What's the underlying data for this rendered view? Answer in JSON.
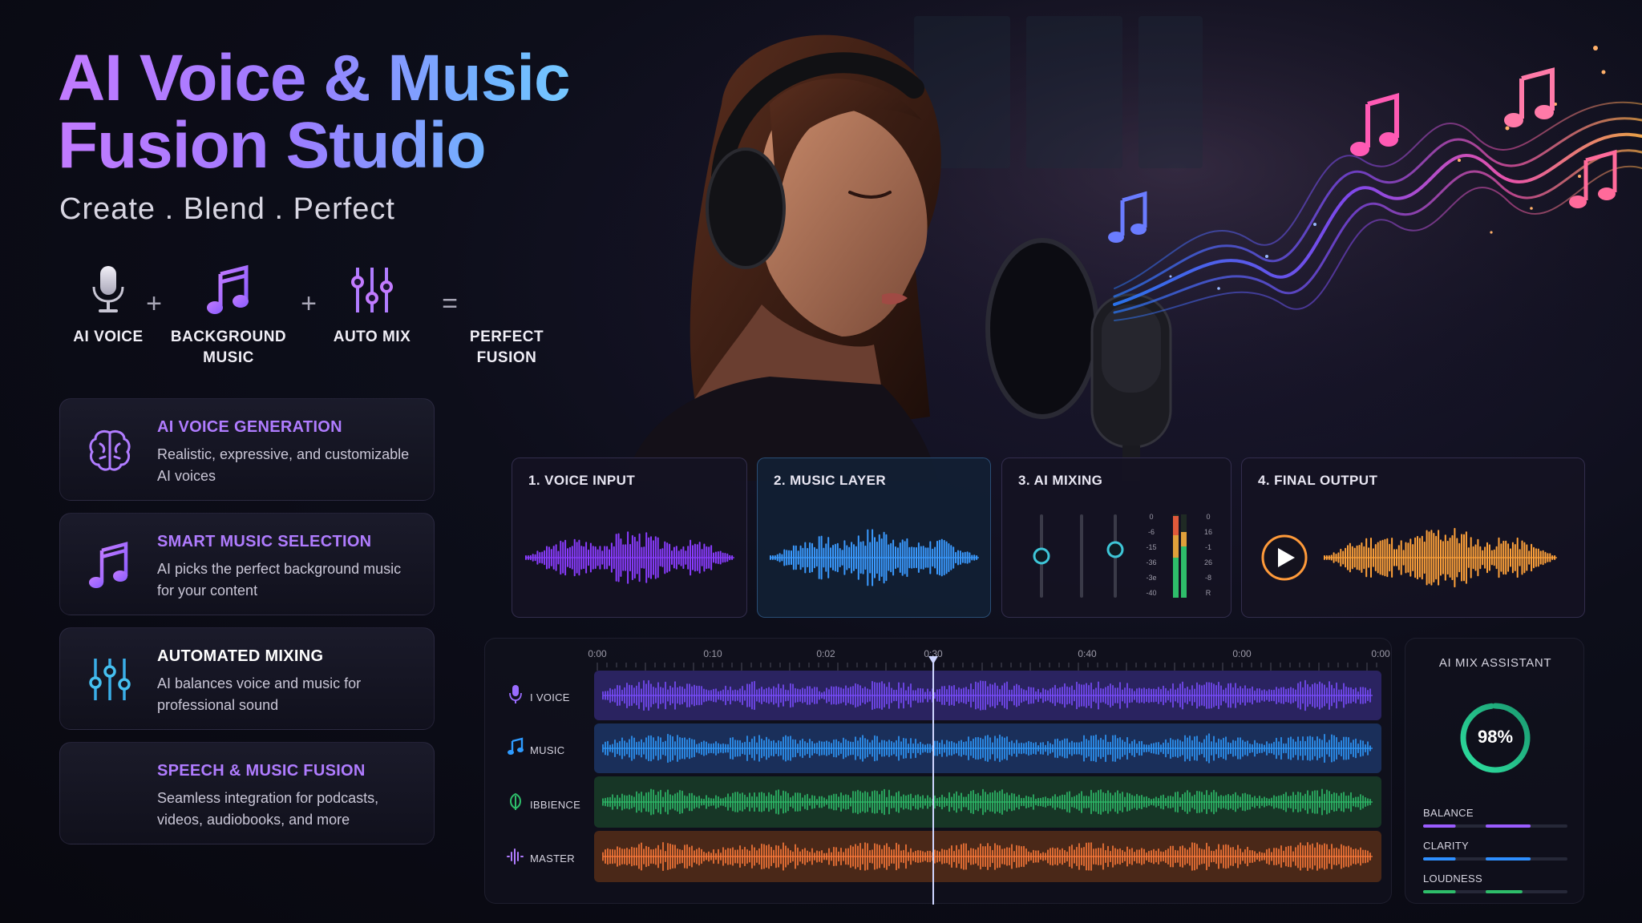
{
  "header": {
    "title_line1": "AI Voice & Music",
    "title_line2": "Fusion Studio",
    "subtitle": "Create . Blend . Perfect"
  },
  "formula": {
    "items": [
      {
        "label": "AI VOICE",
        "icon": "microphone-icon"
      },
      {
        "label": "BACKGROUND\nMUSIC",
        "icon": "music-note-icon"
      },
      {
        "label": "AUTO MIX",
        "icon": "mixer-sliders-icon"
      },
      {
        "label": "PERFECT\nFUSION",
        "icon": "waveform-icon"
      }
    ],
    "operators": [
      "+",
      "+",
      "="
    ]
  },
  "features": [
    {
      "title": "AI VOICE GENERATION",
      "desc": "Realistic, expressive, and customizable AI voices",
      "color": "#b07cff",
      "icon": "brain-icon"
    },
    {
      "title": "SMART MUSIC SELECTION",
      "desc": "AI picks the perfect background music for your content",
      "color": "#b07cff",
      "icon": "music-note-icon"
    },
    {
      "title": "AUTOMATED MIXING",
      "desc": "AI balances voice and music for professional sound",
      "color": "#ffffff",
      "icon": "mixer-sliders-icon"
    },
    {
      "title": "SPEECH & MUSIC FUSION",
      "desc": "Seamless integration for podcasts, videos, audiobooks, and more",
      "color": "#b07cff",
      "icon": "waveform-icon"
    }
  ],
  "steps": [
    {
      "title": "1. VOICE INPUT",
      "color": "#8a3cff"
    },
    {
      "title": "2. MUSIC LAYER",
      "color": "#3a9aff"
    },
    {
      "title": "3. AI MIXING",
      "meter_labels_left": [
        "0",
        "-6",
        "-15",
        "-36",
        "-3e",
        "-40"
      ],
      "meter_labels_right": [
        "0",
        "16",
        "-1",
        "26",
        "-8",
        "R"
      ]
    },
    {
      "title": "4. FINAL OUTPUT",
      "color": "#ffa23a"
    }
  ],
  "timeline": {
    "ticks": [
      "0:00",
      "0:10",
      "0:02",
      "0:30",
      "0:40",
      "0:00",
      "0:00"
    ],
    "tracks": [
      {
        "label": "I VOICE",
        "color": "#7a4cff",
        "bg": "#2a2360",
        "icon": "microphone-icon"
      },
      {
        "label": "MUSIC",
        "color": "#2e9bff",
        "bg": "#1a2f5a",
        "icon": "music-note-icon"
      },
      {
        "label": "IBBIENCE",
        "color": "#2ebd6a",
        "bg": "#173626",
        "icon": "ambience-leaf-icon"
      },
      {
        "label": "MASTER",
        "color": "#ff7a3a",
        "bg": "#4a2818",
        "icon": "waveform-icon"
      }
    ],
    "playhead_time": "0:30"
  },
  "assistant": {
    "title": "AI MIX ASSISTANT",
    "score": "98%",
    "score_value": 0.98,
    "metrics": [
      {
        "label": "BALANCE",
        "color": "#9a5cff",
        "a": 0.58,
        "b": 0.55
      },
      {
        "label": "CLARITY",
        "color": "#2e8fff",
        "a": 0.58,
        "b": 0.55
      },
      {
        "label": "LOUDNESS",
        "color": "#2ebd6a",
        "a": 0.58,
        "b": 0.45
      }
    ]
  }
}
